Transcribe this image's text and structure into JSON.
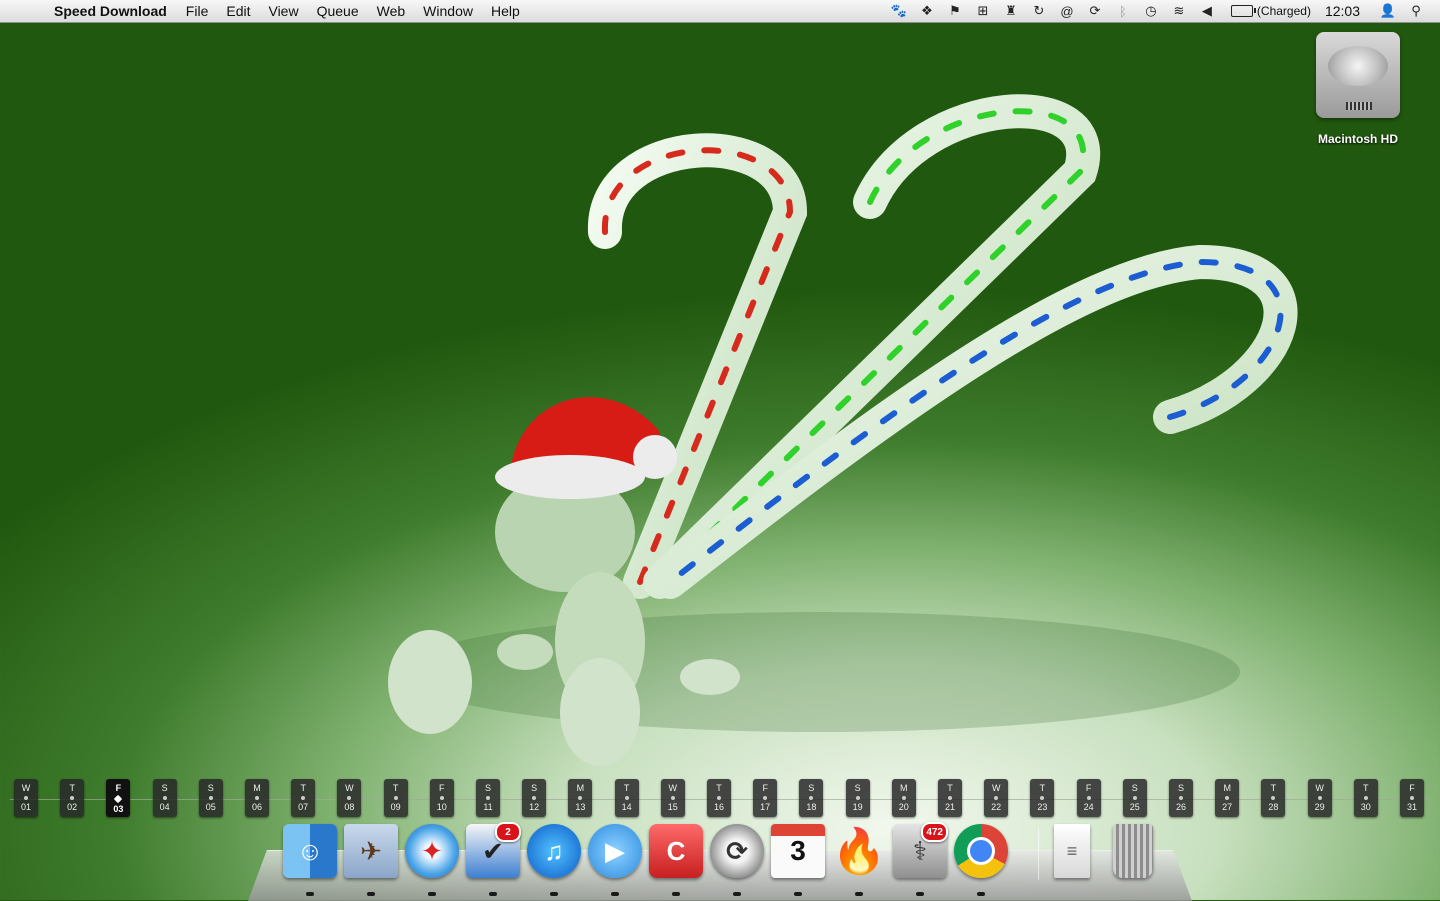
{
  "menubar": {
    "apple_icon": "apple-logo",
    "app_name": "Speed Download",
    "menus": [
      "File",
      "Edit",
      "View",
      "Queue",
      "Web",
      "Window",
      "Help"
    ],
    "status_icons": [
      "growl-icon",
      "dropbox-icon",
      "bookmark-icon",
      "gift-icon",
      "cleaner-icon",
      "sync-arrows-icon",
      "at-sign-icon",
      "refresh-icon",
      "bluetooth-icon",
      "time-machine-icon",
      "wifi-icon",
      "volume-icon"
    ],
    "battery_status": "(Charged)",
    "clock": "12:03"
  },
  "desktop": {
    "drive_label": "Macintosh HD"
  },
  "calendar": {
    "today_index": 2,
    "days": [
      {
        "l": "W",
        "n": "01"
      },
      {
        "l": "T",
        "n": "02"
      },
      {
        "l": "F",
        "n": "03"
      },
      {
        "l": "S",
        "n": "04"
      },
      {
        "l": "S",
        "n": "05"
      },
      {
        "l": "M",
        "n": "06"
      },
      {
        "l": "T",
        "n": "07"
      },
      {
        "l": "W",
        "n": "08"
      },
      {
        "l": "T",
        "n": "09"
      },
      {
        "l": "F",
        "n": "10"
      },
      {
        "l": "S",
        "n": "11"
      },
      {
        "l": "S",
        "n": "12"
      },
      {
        "l": "M",
        "n": "13"
      },
      {
        "l": "T",
        "n": "14"
      },
      {
        "l": "W",
        "n": "15"
      },
      {
        "l": "T",
        "n": "16"
      },
      {
        "l": "F",
        "n": "17"
      },
      {
        "l": "S",
        "n": "18"
      },
      {
        "l": "S",
        "n": "19"
      },
      {
        "l": "M",
        "n": "20"
      },
      {
        "l": "T",
        "n": "21"
      },
      {
        "l": "W",
        "n": "22"
      },
      {
        "l": "T",
        "n": "23"
      },
      {
        "l": "F",
        "n": "24"
      },
      {
        "l": "S",
        "n": "25"
      },
      {
        "l": "S",
        "n": "26"
      },
      {
        "l": "M",
        "n": "27"
      },
      {
        "l": "T",
        "n": "28"
      },
      {
        "l": "W",
        "n": "29"
      },
      {
        "l": "T",
        "n": "30"
      },
      {
        "l": "F",
        "n": "31"
      }
    ]
  },
  "dock": {
    "items": [
      {
        "name": "finder-icon",
        "cls": "finder",
        "glyph": "☺",
        "running": true
      },
      {
        "name": "mail-icon",
        "cls": "mail",
        "glyph": "✈",
        "running": true
      },
      {
        "name": "safari-icon",
        "cls": "safari",
        "glyph": "✦",
        "running": true
      },
      {
        "name": "tasks-icon",
        "cls": "tasks",
        "glyph": "✔",
        "badge": "2",
        "running": true
      },
      {
        "name": "itunes-icon",
        "cls": "itunes",
        "glyph": "♫",
        "running": true
      },
      {
        "name": "facetime-icon",
        "cls": "facetime",
        "glyph": "▶",
        "running": true
      },
      {
        "name": "cocoa-app-icon",
        "cls": "cocoa",
        "glyph": "C",
        "running": true
      },
      {
        "name": "speed-download-icon",
        "cls": "sdl",
        "glyph": "⟳",
        "running": true
      },
      {
        "name": "calendar-icon",
        "cls": "cal",
        "glyph": "3",
        "running": true
      },
      {
        "name": "flame-app-icon",
        "cls": "flame",
        "glyph": "🔥",
        "running": true
      },
      {
        "name": "disk-utility-icon",
        "cls": "diskutil",
        "glyph": "⚕",
        "badge": "472",
        "running": true
      },
      {
        "name": "chrome-icon",
        "cls": "chrome",
        "glyph": "",
        "running": true
      },
      {
        "name": "document-icon",
        "cls": "doc",
        "glyph": "≡",
        "running": false
      },
      {
        "name": "trash-icon",
        "cls": "trash",
        "glyph": "",
        "running": false
      }
    ]
  }
}
